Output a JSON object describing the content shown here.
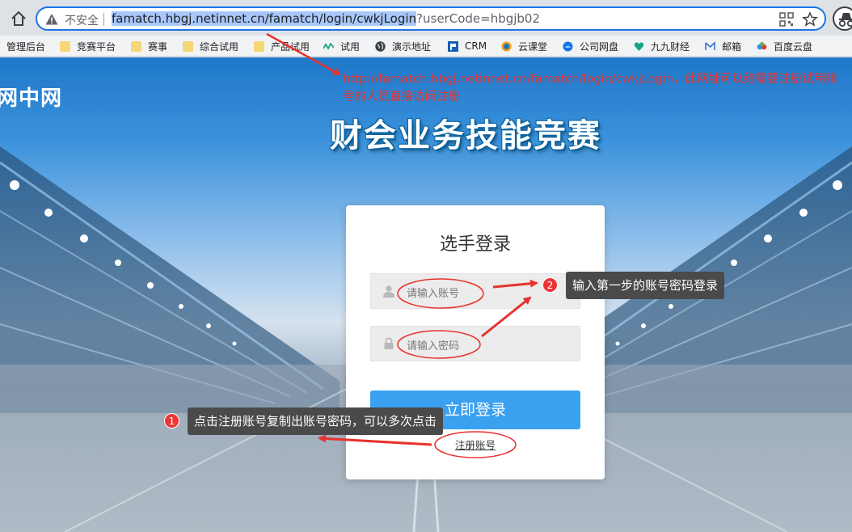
{
  "browser": {
    "insecure_label": "不安全",
    "url_selected": "famatch.hbgj.netinnet.cn/famatch/login/cwkjLogin",
    "url_rest": "?userCode=hbgjb02"
  },
  "bookmarks": [
    {
      "label": "管理后台",
      "icon": "none"
    },
    {
      "label": "竞赛平台",
      "icon": "folder-icon"
    },
    {
      "label": "赛事",
      "icon": "folder-icon"
    },
    {
      "label": "综合试用",
      "icon": "folder-icon"
    },
    {
      "label": "产品试用",
      "icon": "folder-icon"
    },
    {
      "label": "试用",
      "icon": "wave-icon"
    },
    {
      "label": "演示地址",
      "icon": "globe-icon"
    },
    {
      "label": "CRM",
      "icon": "crm-icon"
    },
    {
      "label": "云课堂",
      "icon": "cloud-class-icon"
    },
    {
      "label": "公司网盘",
      "icon": "disk-icon"
    },
    {
      "label": "九九财经",
      "icon": "finance-icon"
    },
    {
      "label": "邮箱",
      "icon": "mail-icon"
    },
    {
      "label": "百度云盘",
      "icon": "baidu-cloud-icon"
    }
  ],
  "page": {
    "logo_text": "网中网",
    "annotation": "http://famatch.hbgj.netinnet.cn/famatch/login/cwkjLogin，此网址可以给需要注册试用账号的人员直接访问注册",
    "title": "财会业务技能竞赛"
  },
  "login": {
    "title": "选手登录",
    "account_placeholder": "请输入账号",
    "password_placeholder": "请输入密码",
    "submit_label": "立即登录",
    "register_label": "注册账号"
  },
  "callouts": {
    "step1_number": "1",
    "step1_text": "点击注册账号复制出账号密码，可以多次点击",
    "step2_number": "2",
    "step2_text": "输入第一步的账号密码登录"
  },
  "colors": {
    "accent": "#3aa0f0",
    "annotation_red": "#e8322d",
    "focus_blue": "#1a73e8"
  }
}
